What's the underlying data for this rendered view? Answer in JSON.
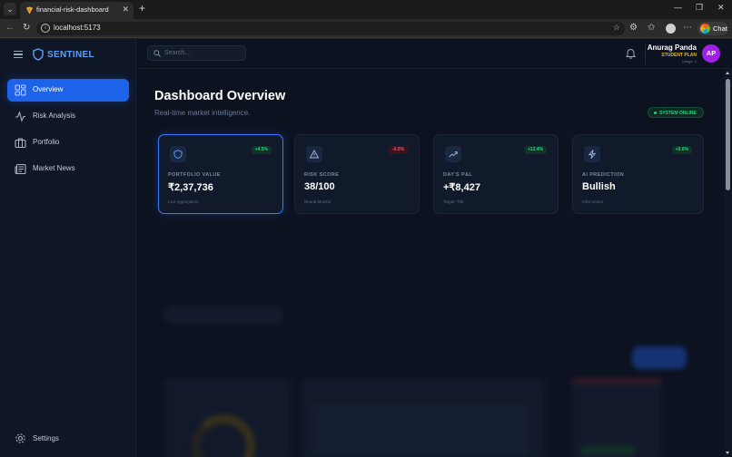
{
  "browser": {
    "tab_title": "financial-risk-dashboard",
    "url": "localhost:5173",
    "chat_label": "Chat"
  },
  "app": {
    "brand": "SENTINEL",
    "nav": [
      {
        "label": "Overview",
        "icon": "grid-icon",
        "active": true
      },
      {
        "label": "Risk Analysis",
        "icon": "activity-icon",
        "active": false
      },
      {
        "label": "Portfolio",
        "icon": "briefcase-icon",
        "active": false
      },
      {
        "label": "Market News",
        "icon": "newspaper-icon",
        "active": false
      }
    ],
    "settings_label": "Settings",
    "search_placeholder": "Search...",
    "user": {
      "name": "Anurag Panda",
      "plan": "STUDENT PLAN",
      "usage": "Usage: 4",
      "initials": "AP"
    }
  },
  "dashboard": {
    "title": "Dashboard Overview",
    "subtitle": "Real-time market intelligence.",
    "status": "SYSTEM ONLINE",
    "status_color": "#22d37a",
    "cards": [
      {
        "label": "PORTFOLIO VALUE",
        "value": "₹2,37,736",
        "note": "Live Aggregation",
        "badge": "+4.5%",
        "trend": "up",
        "icon": "shield-icon"
      },
      {
        "label": "RISK SCORE",
        "value": "38/100",
        "note": "Neural Monitor",
        "badge": "-0.5%",
        "trend": "down",
        "icon": "alert-triangle-icon"
      },
      {
        "label": "DAY'S P&L",
        "value": "+₹8,427",
        "note": "Target: ₹9k",
        "badge": "+12.4%",
        "trend": "up",
        "icon": "trending-up-icon"
      },
      {
        "label": "AI PREDICTION",
        "value": "Bullish",
        "note": "Infra Sector",
        "badge": "+0.0%",
        "trend": "up",
        "icon": "zap-icon"
      }
    ]
  },
  "colors": {
    "accent": "#1d63ea",
    "brand": "#5aa0ff",
    "up": "#26d981",
    "down": "#ff4d6a",
    "avatar": "#a020e8",
    "plan": "#e7b53a"
  }
}
